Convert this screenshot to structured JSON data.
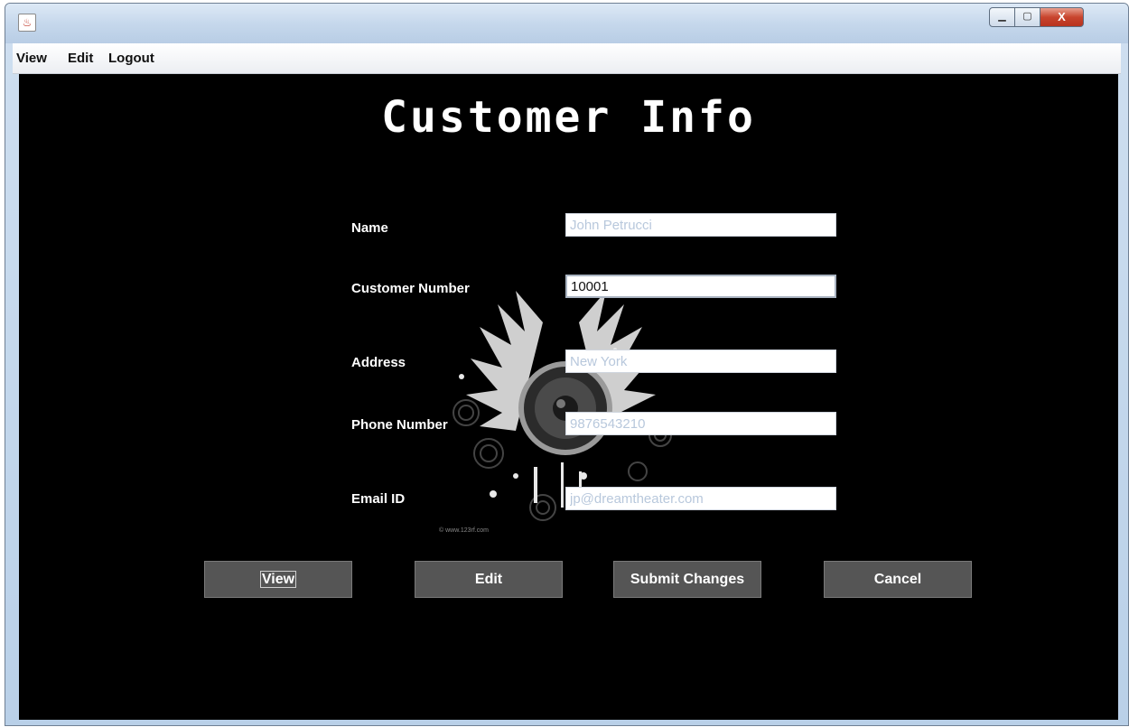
{
  "window": {
    "app_icon": "java-cup-icon",
    "controls": {
      "minimize": "▁",
      "maximize": "▢",
      "close": "X"
    }
  },
  "menu": {
    "items": [
      {
        "label": "View"
      },
      {
        "label": "Edit"
      },
      {
        "label": "Logout"
      }
    ]
  },
  "page": {
    "title": "Customer Info"
  },
  "art": {
    "credit": "© www.123rf.com"
  },
  "form": {
    "fields": [
      {
        "label": "Name",
        "value": "John Petrucci"
      },
      {
        "label": "Customer Number",
        "value": "10001"
      },
      {
        "label": "Address",
        "value": "New York"
      },
      {
        "label": "Phone Number",
        "value": "9876543210"
      },
      {
        "label": "Email ID",
        "value": "jp@dreamtheater.com"
      }
    ]
  },
  "buttons": {
    "view": "View",
    "edit": "Edit",
    "submit": "Submit Changes",
    "cancel": "Cancel"
  },
  "colors": {
    "background": "#000000",
    "button": "#555555",
    "input_text_disabled": "#b8c8dc",
    "title_text": "#ffffff"
  }
}
